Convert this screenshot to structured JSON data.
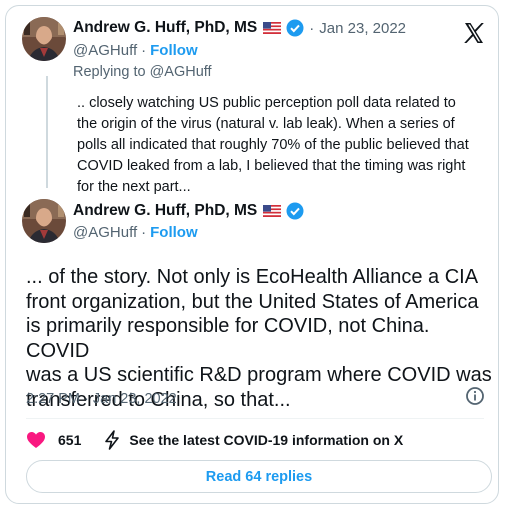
{
  "quoted_tweet": {
    "author_name": "Andrew G. Huff, PhD, MS",
    "handle": "@AGHuff",
    "follow_label": "Follow",
    "separator": "·",
    "date": "Jan 23, 2022",
    "replying_to_prefix": "Replying to ",
    "replying_to_handle": "@AGHuff",
    "text_lines": [
      ".. closely watching US public perception poll data related to",
      "the origin of the virus (natural v. lab leak). When a series of",
      "polls all indicated that roughly 70% of the public believed that",
      "COVID leaked from a lab, I believed that the timing was right",
      "for the next part..."
    ]
  },
  "main_tweet": {
    "author_name": "Andrew G. Huff, PhD, MS",
    "handle": "@AGHuff",
    "follow_label": "Follow",
    "separator": "·",
    "text_lines": [
      "... of the story. Not only is EcoHealth Alliance a CIA",
      "front organization, but the United States of America",
      "is primarily responsible for COVID, not China. COVID",
      "was a US scientific R&D program where COVID was",
      "transferred to China, so that..."
    ],
    "timestamp": "2:27 PM · Jan 23, 2022"
  },
  "actions": {
    "like_count": "651",
    "covid_info_label": "See the latest COVID-19 information on X"
  },
  "replies_button_label": "Read 64 replies",
  "icons": {
    "brand": "x-logo-icon",
    "flag": "us-flag-icon",
    "verified": "verified-badge-icon",
    "like": "heart-icon",
    "info": "info-icon",
    "bolt": "lightning-icon"
  },
  "colors": {
    "accent": "#1d9bf0",
    "like": "#f91880",
    "text": "#0f1419",
    "muted": "#536471",
    "border": "#cfd9de"
  }
}
